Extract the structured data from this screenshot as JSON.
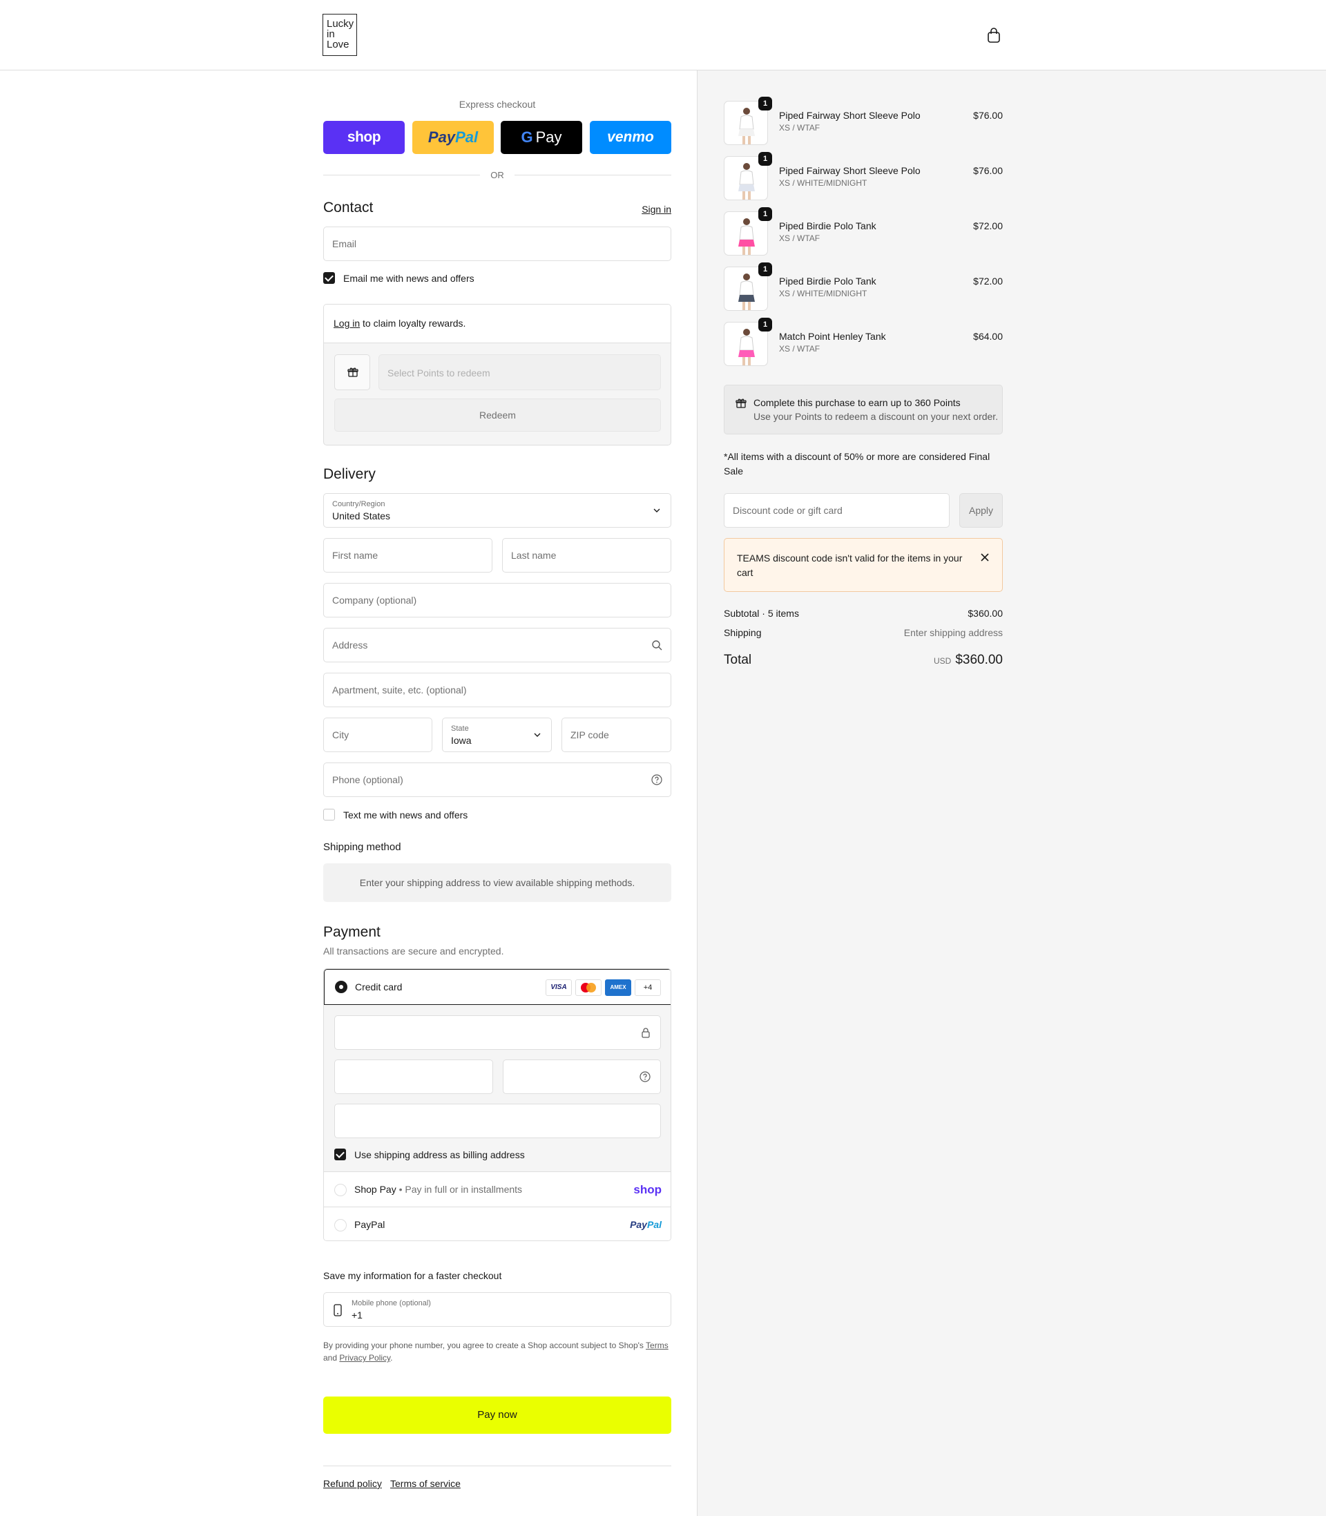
{
  "brand": {
    "logo_lines": [
      "Lucky",
      "in",
      "Love"
    ]
  },
  "express": {
    "title": "Express checkout",
    "shop_label": "shop",
    "paypal_label_1": "Pay",
    "paypal_label_2": "Pal",
    "gpay_g": "G",
    "gpay_label": "Pay",
    "venmo_label": "venmo",
    "or_label": "OR"
  },
  "contact": {
    "heading": "Contact",
    "sign_in": "Sign in",
    "email_placeholder": "Email",
    "email_news_label": "Email me with news and offers",
    "email_news_checked": true
  },
  "loyalty": {
    "login_link": "Log in",
    "login_text": " to claim loyalty rewards.",
    "points_placeholder": "Select Points to redeem",
    "redeem_label": "Redeem"
  },
  "delivery": {
    "heading": "Delivery",
    "country_label": "Country/Region",
    "country_value": "United States",
    "first_name_placeholder": "First name",
    "last_name_placeholder": "Last name",
    "company_placeholder": "Company (optional)",
    "address_placeholder": "Address",
    "apartment_placeholder": "Apartment, suite, etc. (optional)",
    "city_placeholder": "City",
    "state_label": "State",
    "state_value": "Iowa",
    "zip_placeholder": "ZIP code",
    "phone_placeholder": "Phone (optional)",
    "text_news_label": "Text me with news and offers",
    "text_news_checked": false
  },
  "shipping_method": {
    "heading": "Shipping method",
    "message": "Enter your shipping address to view available shipping methods."
  },
  "payment": {
    "heading": "Payment",
    "subtitle": "All transactions are secure and encrypted.",
    "credit_card_label": "Credit card",
    "card_logos": [
      "VISA",
      "MC",
      "AMEX",
      "+4"
    ],
    "billing_same_label": "Use shipping address as billing address",
    "billing_same_checked": true,
    "shop_pay_label": "Shop Pay",
    "shop_pay_sub": "Pay in full or in installments",
    "shop_pay_logo": "shop",
    "paypal_label": "PayPal",
    "paypal_logo_1": "Pay",
    "paypal_logo_2": "Pal"
  },
  "save_info": {
    "heading": "Save my information for a faster checkout",
    "mobile_label": "Mobile phone (optional)",
    "mobile_value": "+1",
    "legal_text": "By providing your phone number, you agree to create a Shop account subject to Shop's ",
    "terms_link": "Terms",
    "legal_and": "and ",
    "privacy_link": "Privacy Policy",
    "legal_end": "."
  },
  "pay_now_label": "Pay now",
  "footer": {
    "refund": "Refund policy",
    "terms": "Terms of service"
  },
  "cart": {
    "items": [
      {
        "name": "Piped Fairway Short Sleeve Polo",
        "variant": "XS / WTAF",
        "price": "$76.00",
        "qty": "1",
        "accent": "#f2f2f2"
      },
      {
        "name": "Piped Fairway Short Sleeve Polo",
        "variant": "XS / WHITE/MIDNIGHT",
        "price": "$76.00",
        "qty": "1",
        "accent": "#dfe4ee"
      },
      {
        "name": "Piped Birdie Polo Tank",
        "variant": "XS / WTAF",
        "price": "$72.00",
        "qty": "1",
        "accent": "#ff4fa3"
      },
      {
        "name": "Piped Birdie Polo Tank",
        "variant": "XS / WHITE/MIDNIGHT",
        "price": "$72.00",
        "qty": "1",
        "accent": "#4a5568"
      },
      {
        "name": "Match Point Henley Tank",
        "variant": "XS / WTAF",
        "price": "$64.00",
        "qty": "1",
        "accent": "#ff5cb8"
      }
    ],
    "points_line1": "Complete this purchase to earn up to 360 Points",
    "points_line2": "Use your Points to redeem a discount on your next order.",
    "final_sale": "*All items with a discount of 50% or more are considered Final Sale",
    "discount_placeholder": "Discount code or gift card",
    "apply_label": "Apply",
    "warning": "TEAMS discount code isn't valid for the items in your cart",
    "subtotal_label": "Subtotal · 5 items",
    "subtotal_value": "$360.00",
    "shipping_label": "Shipping",
    "shipping_value": "Enter shipping address",
    "total_label": "Total",
    "total_currency": "USD",
    "total_value": "$360.00"
  },
  "colors": {
    "pay_now": "#eaff00",
    "shop_purple": "#5a31f4",
    "venmo_blue": "#008cff",
    "paypal_yellow": "#ffc439"
  }
}
